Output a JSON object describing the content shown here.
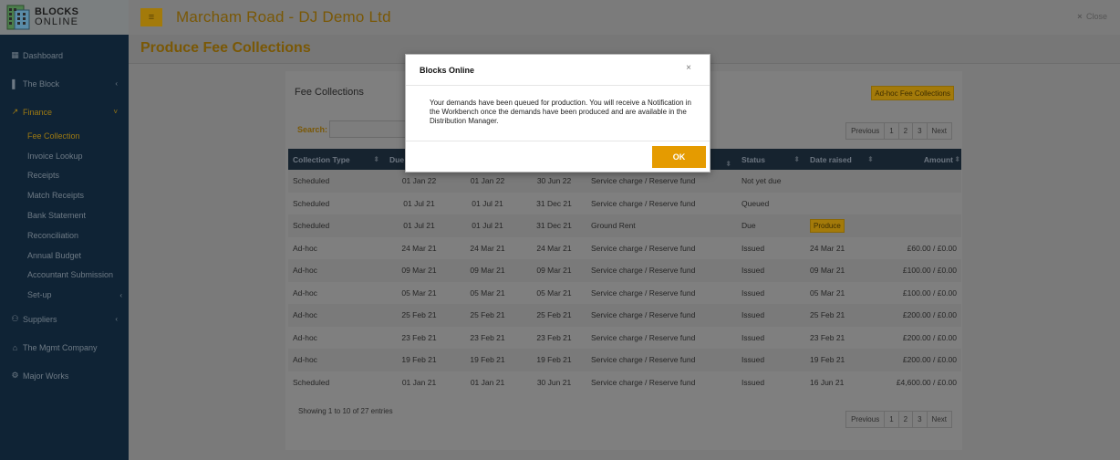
{
  "brand": {
    "line1": "BLOCKS",
    "line2": "ONLINE"
  },
  "sidebar": {
    "items": [
      {
        "label": "Dashboard",
        "icon": "dashboard-icon",
        "glyph": "▦"
      },
      {
        "label": "The Block",
        "icon": "building-icon",
        "glyph": "▌",
        "chevron": "‹"
      },
      {
        "label": "Finance",
        "icon": "chart-icon",
        "glyph": "↗",
        "chevron": "˅"
      }
    ],
    "finance_sub": [
      {
        "label": "Fee Collection"
      },
      {
        "label": "Invoice Lookup"
      },
      {
        "label": "Receipts"
      },
      {
        "label": "Match Receipts"
      },
      {
        "label": "Bank Statement"
      },
      {
        "label": "Reconciliation"
      },
      {
        "label": "Annual Budget"
      },
      {
        "label": "Accountant Submission"
      },
      {
        "label": "Set-up",
        "chevron": "‹"
      }
    ],
    "bottom_items": [
      {
        "label": "Suppliers",
        "icon": "users-icon",
        "glyph": "⚇",
        "chevron": "‹"
      },
      {
        "label": "The Mgmt Company",
        "icon": "bank-icon",
        "glyph": "⌂"
      },
      {
        "label": "Major Works",
        "icon": "cogs-icon",
        "glyph": "⚙"
      }
    ]
  },
  "header": {
    "menu_glyph": "≡",
    "title": "Marcham Road - DJ Demo Ltd",
    "close_x": "×",
    "close_label": "Close"
  },
  "page": {
    "title": "Produce Fee Collections"
  },
  "panel": {
    "title": "Fee Collections",
    "adhoc_button": "Ad-hoc Fee Collections",
    "search_label": "Search:",
    "search_value": "",
    "pagination": [
      "Previous",
      "1",
      "2",
      "3",
      "Next"
    ],
    "footer_info": "Showing 1 to 10 of 27 entries"
  },
  "table": {
    "columns": [
      "Collection Type",
      "Due",
      "",
      "",
      "",
      "Status",
      "Date raised",
      "Amount"
    ],
    "sort_glyph": "⬍",
    "rows": [
      {
        "type": "Scheduled",
        "d1": "01 Jan 22",
        "d2": "01 Jan 22",
        "d3": "30 Jun 22",
        "desc": "Service charge / Reserve fund",
        "status": "Not yet due",
        "raised": "",
        "amount": ""
      },
      {
        "type": "Scheduled",
        "d1": "01 Jul 21",
        "d2": "01 Jul 21",
        "d3": "31 Dec 21",
        "desc": "Service charge / Reserve fund",
        "status": "Queued",
        "raised": "",
        "amount": ""
      },
      {
        "type": "Scheduled",
        "d1": "01 Jul 21",
        "d2": "01 Jul 21",
        "d3": "31 Dec 21",
        "desc": "Ground Rent",
        "status": "Due",
        "raised": "Produce",
        "amount": ""
      },
      {
        "type": "Ad-hoc",
        "d1": "24 Mar 21",
        "d2": "24 Mar 21",
        "d3": "24 Mar 21",
        "desc": "Service charge / Reserve fund",
        "status": "Issued",
        "raised": "24 Mar 21",
        "amount": "£60.00 / £0.00"
      },
      {
        "type": "Ad-hoc",
        "d1": "09 Mar 21",
        "d2": "09 Mar 21",
        "d3": "09 Mar 21",
        "desc": "Service charge / Reserve fund",
        "status": "Issued",
        "raised": "09 Mar 21",
        "amount": "£100.00 / £0.00"
      },
      {
        "type": "Ad-hoc",
        "d1": "05 Mar 21",
        "d2": "05 Mar 21",
        "d3": "05 Mar 21",
        "desc": "Service charge / Reserve fund",
        "status": "Issued",
        "raised": "05 Mar 21",
        "amount": "£100.00 / £0.00"
      },
      {
        "type": "Ad-hoc",
        "d1": "25 Feb 21",
        "d2": "25 Feb 21",
        "d3": "25 Feb 21",
        "desc": "Service charge / Reserve fund",
        "status": "Issued",
        "raised": "25 Feb 21",
        "amount": "£200.00 / £0.00"
      },
      {
        "type": "Ad-hoc",
        "d1": "23 Feb 21",
        "d2": "23 Feb 21",
        "d3": "23 Feb 21",
        "desc": "Service charge / Reserve fund",
        "status": "Issued",
        "raised": "23 Feb 21",
        "amount": "£200.00 / £0.00"
      },
      {
        "type": "Ad-hoc",
        "d1": "19 Feb 21",
        "d2": "19 Feb 21",
        "d3": "19 Feb 21",
        "desc": "Service charge / Reserve fund",
        "status": "Issued",
        "raised": "19 Feb 21",
        "amount": "£200.00 / £0.00"
      },
      {
        "type": "Scheduled",
        "d1": "01 Jan 21",
        "d2": "01 Jan 21",
        "d3": "30 Jun 21",
        "desc": "Service charge / Reserve fund",
        "status": "Issued",
        "raised": "16 Jun 21",
        "amount": "£4,600.00 / £0.00"
      }
    ]
  },
  "modal": {
    "title": "Blocks Online",
    "close_glyph": "×",
    "message": "Your demands have been queued for production. You will receive a Notification in the Workbench once the demands have been produced and are available in the Distribution Manager.",
    "ok_label": "OK"
  },
  "colors": {
    "accent": "#e59b00",
    "sidebar_bg": "#0f2335",
    "overlay": "#7a7a7a"
  }
}
